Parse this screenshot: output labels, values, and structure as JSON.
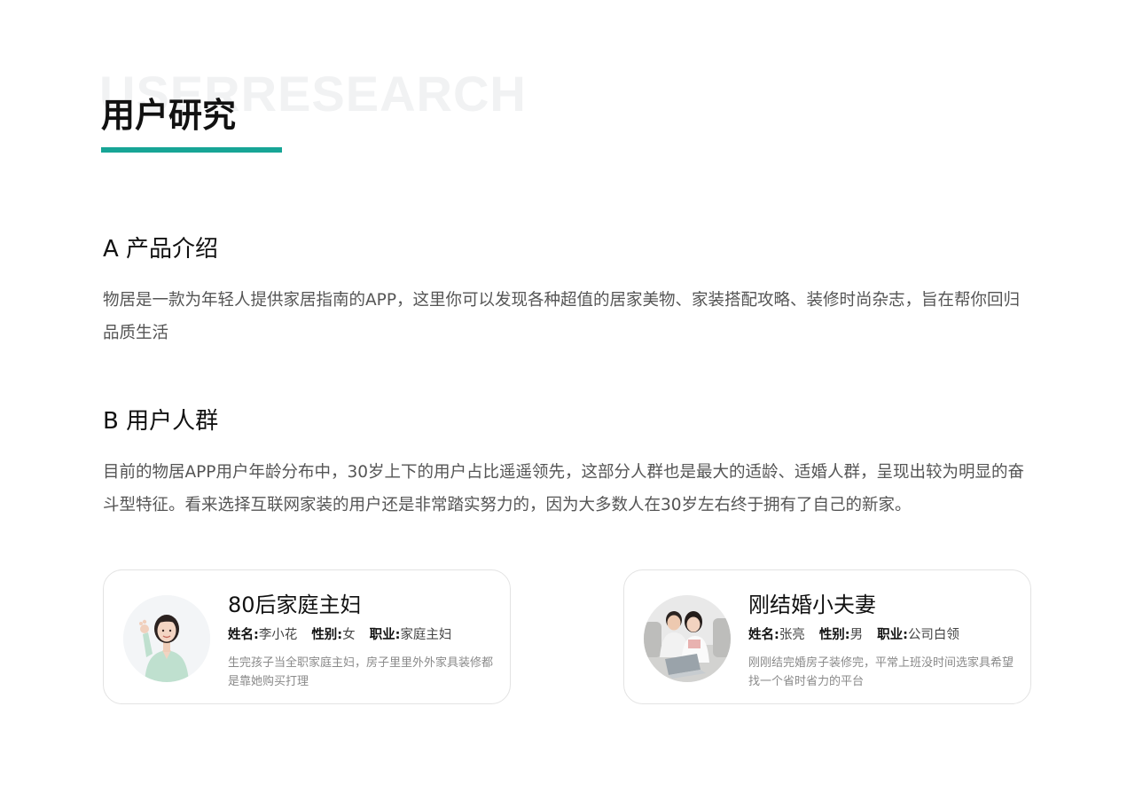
{
  "header": {
    "watermark": "USERRESEARCH",
    "title": "用户研究"
  },
  "sections": [
    {
      "heading": "A 产品介绍",
      "body": "物居是一款为年轻人提供家居指南的APP，这里你可以发现各种超值的居家美物、家装搭配攻略、装修时尚杂志，旨在帮你回归品质生活"
    },
    {
      "heading": "B 用户人群",
      "body": "目前的物居APP用户年龄分布中，30岁上下的用户占比遥遥领先，这部分人群也是最大的适龄、适婚人群，呈现出较为明显的奋斗型特征。看来选择互联网家装的用户还是非常踏实努力的，因为大多数人在30岁左右终于拥有了自己的新家。"
    }
  ],
  "personas": [
    {
      "title": "80后家庭主妇",
      "name_label": "姓名:",
      "name": "李小花",
      "gender_label": "性别:",
      "gender": "女",
      "job_label": "职业:",
      "job": "家庭主妇",
      "desc": "生完孩子当全职家庭主妇，房子里里外外家具装修都是靠她购买打理",
      "avatar_icon": "woman-ok-gesture-photo"
    },
    {
      "title": "刚结婚小夫妻",
      "name_label": "姓名:",
      "name": "张亮",
      "gender_label": "性别:",
      "gender": "男",
      "job_label": "职业:",
      "job": "公司白领",
      "desc": "刚刚结完婚房子装修完，平常上班没时间选家具希望找一个省时省力的平台",
      "avatar_icon": "couple-on-sofa-photo"
    }
  ],
  "colors": {
    "accent": "#17a596",
    "watermark": "#f1f2f3",
    "body_text": "#555555",
    "muted_text": "#8a8a8a",
    "card_border": "#e3e3e3"
  }
}
